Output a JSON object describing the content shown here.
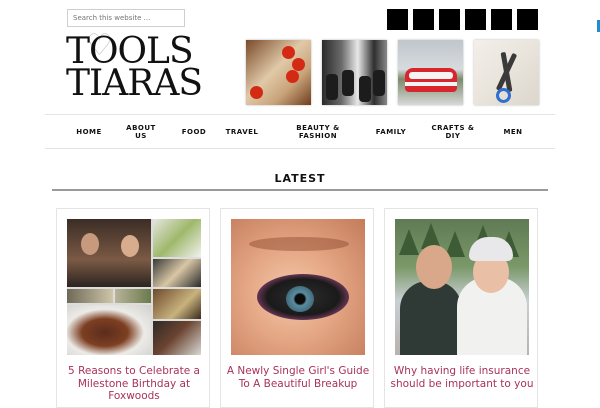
{
  "header": {
    "search_placeholder": "Search this website ...",
    "logo_line1": "TOOLS",
    "logo_line2": "TIARAS"
  },
  "social_icons": [
    "social-icon-1",
    "social-icon-2",
    "social-icon-3",
    "social-icon-4",
    "social-icon-5",
    "social-icon-6"
  ],
  "nav": {
    "items": [
      "HOME",
      "ABOUT US",
      "FOOD",
      "TRAVEL",
      "BEAUTY & FASHION",
      "FAMILY",
      "CRAFTS & DIY",
      "MEN"
    ]
  },
  "latest": {
    "heading": "LATEST"
  },
  "posts": [
    {
      "title": "5 Reasons to Celebrate a Milestone Birthday at Foxwoods"
    },
    {
      "title": "A Newly Single Girl's Guide To A Beautiful Breakup"
    },
    {
      "title": "Why having life insurance should be important to you"
    }
  ],
  "colors": {
    "post_title": "#a8325a",
    "accent_tick": "#1b8fd1",
    "social_square": "#000000"
  }
}
